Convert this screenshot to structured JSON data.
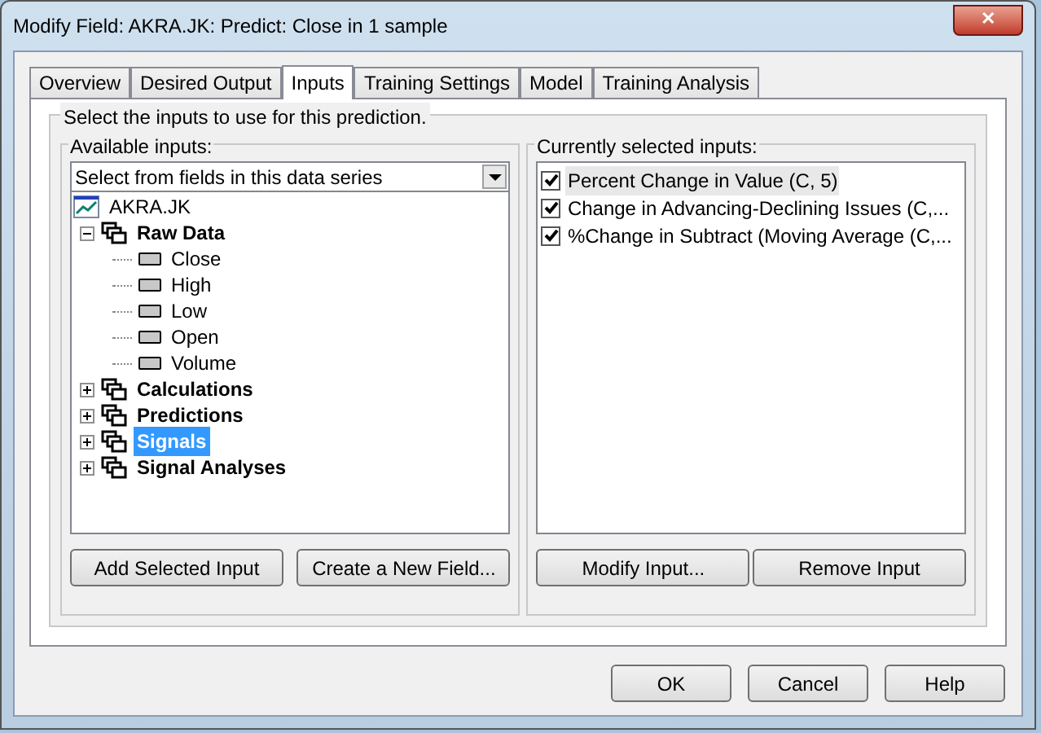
{
  "window": {
    "title": "Modify Field: AKRA.JK: Predict: Close in 1 sample",
    "close": "✕"
  },
  "tabs": [
    {
      "label": "Overview",
      "selected": false
    },
    {
      "label": "Desired Output",
      "selected": false
    },
    {
      "label": "Inputs",
      "selected": true
    },
    {
      "label": "Training Settings",
      "selected": false
    },
    {
      "label": "Model",
      "selected": false
    },
    {
      "label": "Training Analysis",
      "selected": false
    }
  ],
  "group_title": "Select the inputs to use for this prediction.",
  "available": {
    "title": "Available inputs:",
    "dropdown": "Select from fields in this data series",
    "tree": [
      {
        "label": "AKRA.JK",
        "kind": "series",
        "children": [
          {
            "label": "Raw Data",
            "kind": "group",
            "expanded": true,
            "selected": false,
            "children": [
              {
                "label": "Close",
                "kind": "field"
              },
              {
                "label": "High",
                "kind": "field"
              },
              {
                "label": "Low",
                "kind": "field"
              },
              {
                "label": "Open",
                "kind": "field"
              },
              {
                "label": "Volume",
                "kind": "field"
              }
            ]
          },
          {
            "label": "Calculations",
            "kind": "group",
            "expanded": false,
            "selected": false
          },
          {
            "label": "Predictions",
            "kind": "group",
            "expanded": false,
            "selected": false
          },
          {
            "label": "Signals",
            "kind": "group",
            "expanded": false,
            "selected": true
          },
          {
            "label": "Signal Analyses",
            "kind": "group",
            "expanded": false,
            "selected": false
          }
        ]
      }
    ],
    "buttons": [
      "Add Selected Input",
      "Create a New Field..."
    ]
  },
  "selected_inputs": {
    "title": "Currently selected inputs:",
    "items": [
      {
        "label": "Percent Change in Value (C, 5)",
        "checked": true,
        "selected": true
      },
      {
        "label": "Change in Advancing-Declining Issues (C,...",
        "checked": true,
        "selected": false
      },
      {
        "label": "%Change in Subtract (Moving Average (C,...",
        "checked": true,
        "selected": false
      }
    ],
    "buttons": [
      "Modify Input...",
      "Remove Input"
    ]
  },
  "footer_buttons": [
    "OK",
    "Cancel",
    "Help"
  ]
}
